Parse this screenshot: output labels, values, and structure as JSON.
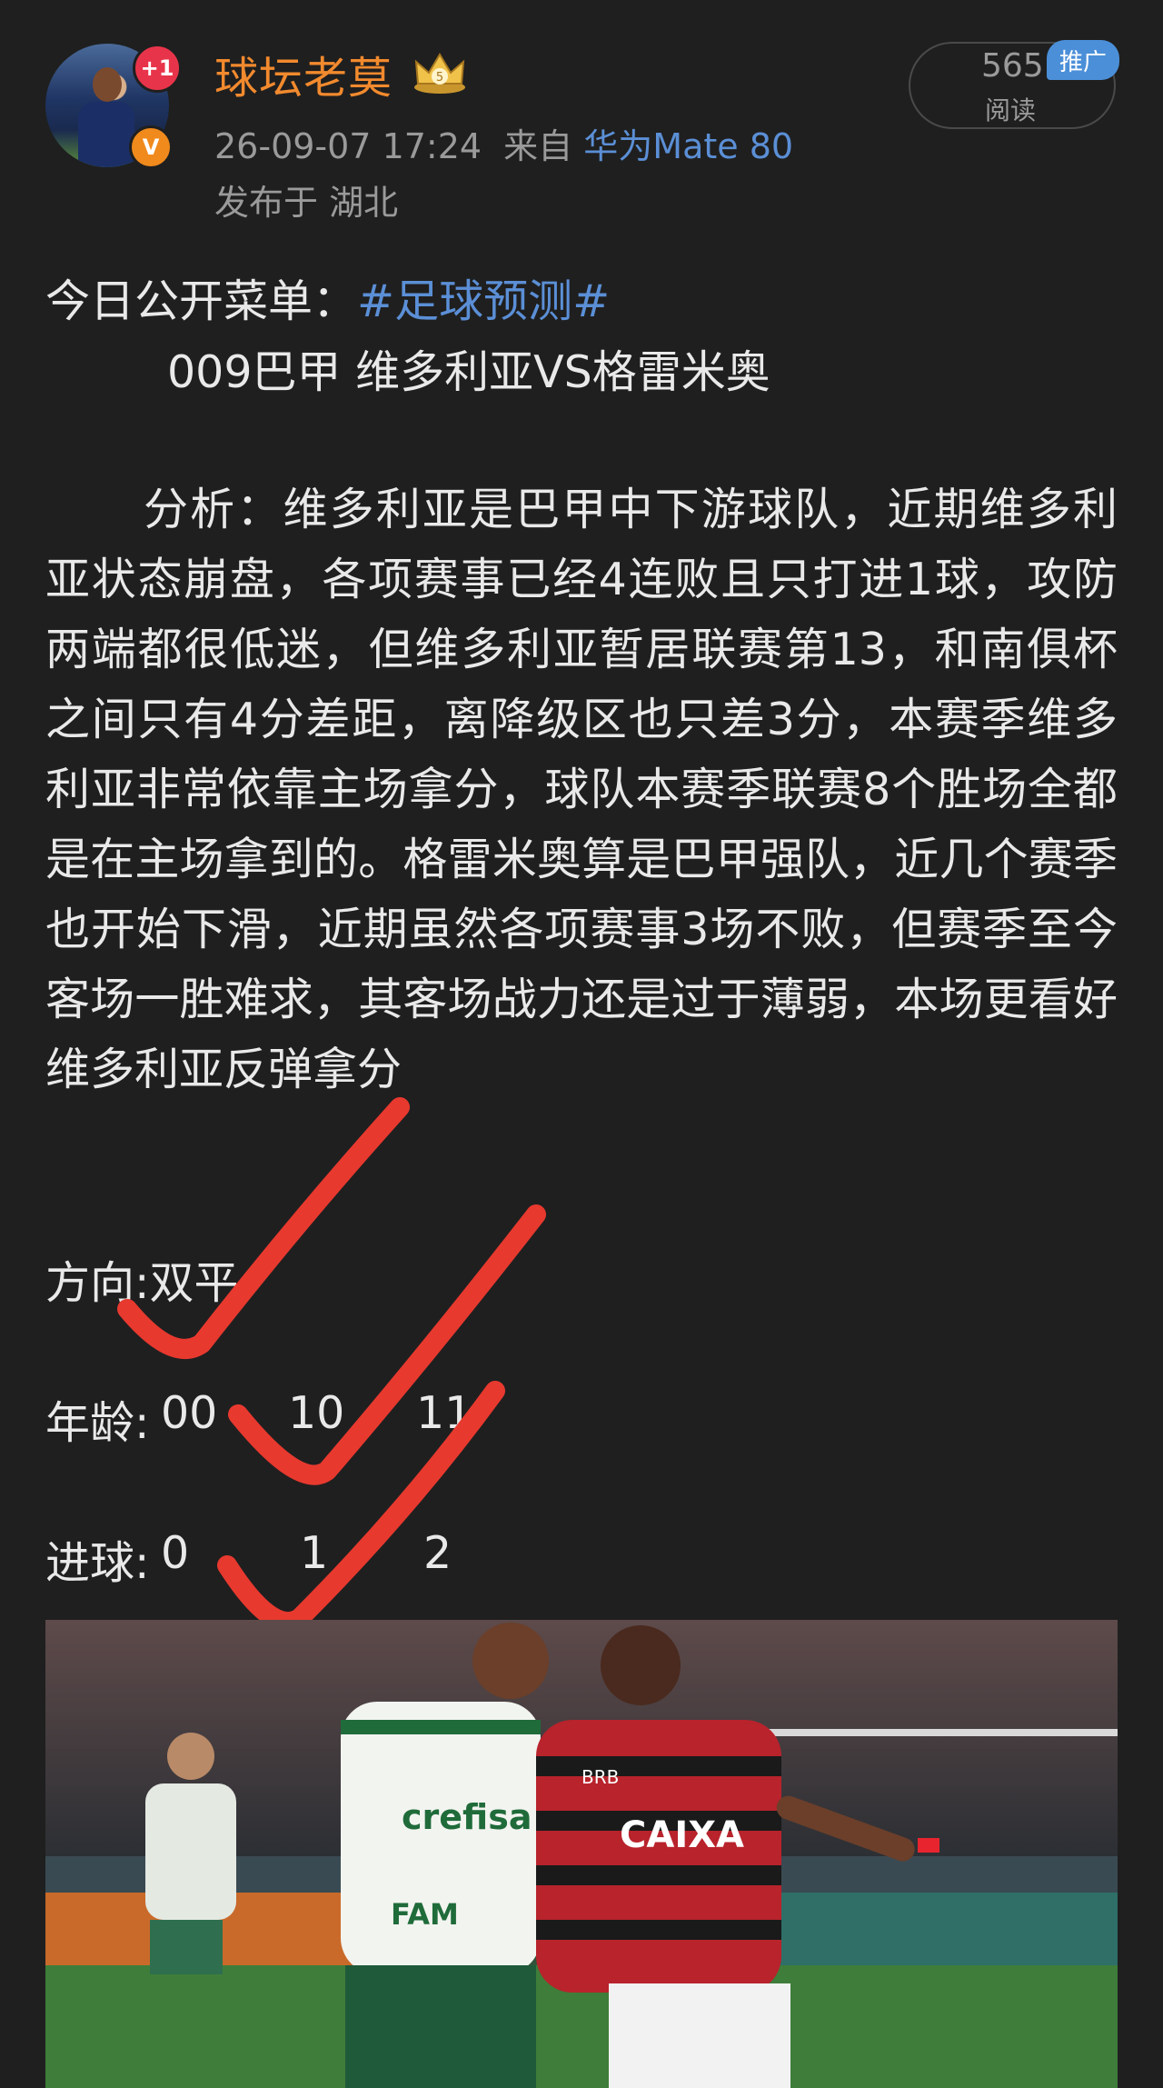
{
  "author": {
    "name": "球坛老莫",
    "plus_badge": "+1",
    "verified_badge": "V",
    "level": "5"
  },
  "post_meta": {
    "datetime": "26-09-07 17:24",
    "source_prefix": "来自",
    "device": "华为Mate 80",
    "location": "发布于 湖北"
  },
  "stats": {
    "read_count": "565",
    "read_label": "阅读",
    "promo_tag": "推广"
  },
  "post": {
    "intro": "今日公开菜单：",
    "hashtag": "#足球预测#",
    "match": "009巴甲 维多利亚VS格雷米奥",
    "analysis": "分析：维多利亚是巴甲中下游球队，近期维多利亚状态崩盘，各项赛事已经4连败且只打进1球，攻防两端都很低迷，但维多利亚暂居联赛第13，和南俱杯之间只有4分差距，离降级区也只差3分，本赛季维多利亚非常依靠主场拿分，球队本赛季联赛8个胜场全都是在主场拿到的。格雷米奥算是巴甲强队，近几个赛季也开始下滑，近期虽然各项赛事3场不败，但赛季至今客场一胜难求，其客场战力还是过于薄弱，本场更看好维多利亚反弹拿分",
    "direction_label": "方向:",
    "direction_value": "双平",
    "age_label": "年龄:",
    "age_values": [
      "00",
      "10",
      "11"
    ],
    "goals_label": "进球:",
    "goals_values": [
      "0",
      "1",
      "2"
    ]
  },
  "colors": {
    "background": "#1f1f1f",
    "username": "#f28a2e",
    "link": "#5b8fd6",
    "check_marks": "#e8392f",
    "promo": "#4b8fd8"
  },
  "image": {
    "subject": "football-match-photo",
    "jersey_texts": [
      "crefisa",
      "FAM",
      "CAIXA",
      "BRB"
    ]
  }
}
